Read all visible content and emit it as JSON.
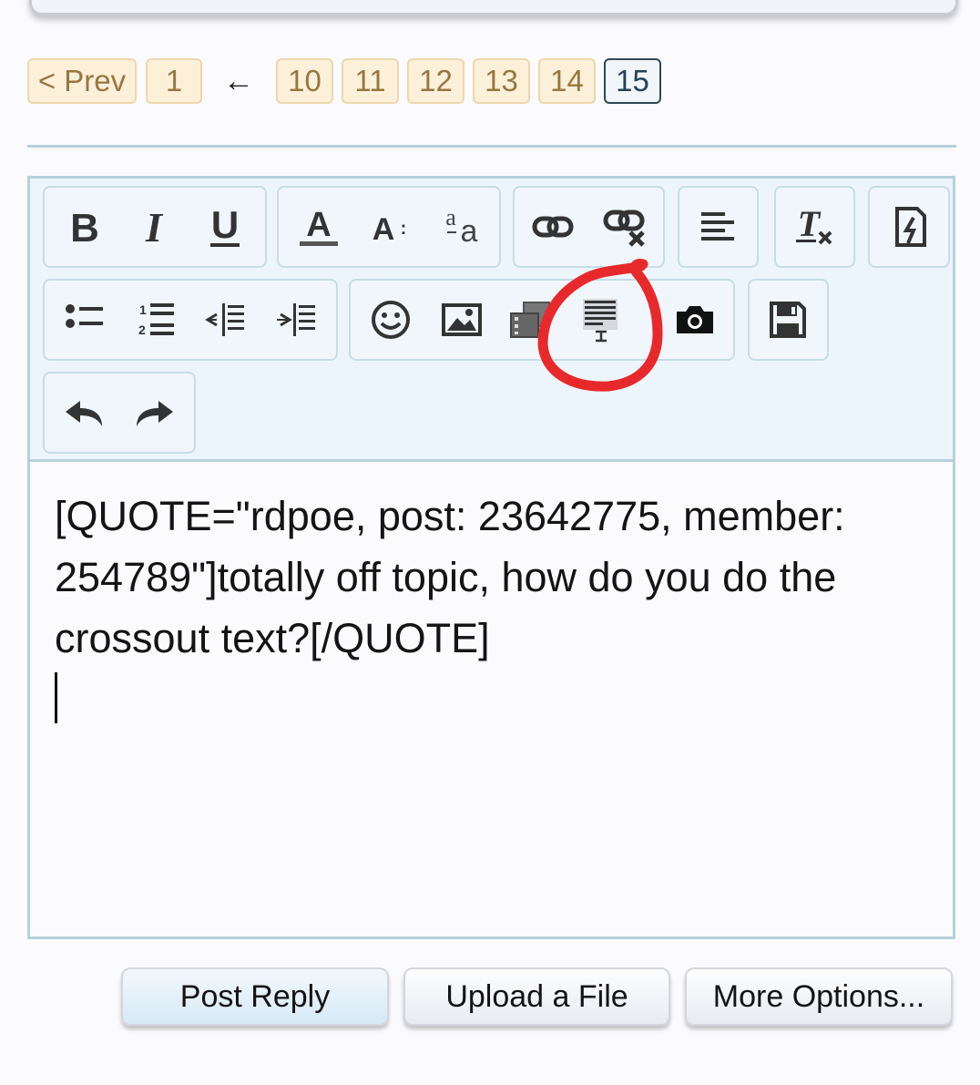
{
  "pagination": {
    "prev_label": "< Prev",
    "first_page": "1",
    "ellipsis_arrow": "←",
    "pages": [
      "10",
      "11",
      "12",
      "13",
      "14"
    ],
    "current_page": "15"
  },
  "toolbar": {
    "row1": [
      {
        "group": "text-style",
        "buttons": [
          "bold-icon",
          "italic-icon",
          "underline-icon"
        ]
      },
      {
        "group": "font",
        "buttons": [
          "font-color-icon",
          "font-size-icon",
          "font-family-icon"
        ]
      },
      {
        "group": "links",
        "buttons": [
          "link-icon",
          "unlink-icon"
        ]
      },
      {
        "group": "align",
        "buttons": [
          "align-icon"
        ]
      },
      {
        "group": "clear",
        "buttons": [
          "remove-format-icon"
        ]
      },
      {
        "group": "bbcode",
        "buttons": [
          "bbcode-toggle-icon"
        ]
      }
    ],
    "row2": [
      {
        "group": "lists",
        "buttons": [
          "bullet-list-icon",
          "numbered-list-icon",
          "outdent-icon",
          "indent-icon"
        ]
      },
      {
        "group": "insert",
        "buttons": [
          "smilie-icon",
          "image-icon",
          "media-icon",
          "insert-text-block-icon",
          "camera-icon"
        ]
      },
      {
        "group": "drafts",
        "buttons": [
          "save-draft-icon"
        ]
      }
    ],
    "row3": [
      {
        "group": "history",
        "buttons": [
          "undo-icon",
          "redo-icon"
        ]
      }
    ],
    "highlight_color": "#e8292b"
  },
  "editor": {
    "content": "[QUOTE=\"rdpoe, post: 23642775, member: 254789\"]totally off topic, how do you do the crossout text?[/QUOTE]"
  },
  "actions": {
    "post_reply": "Post Reply",
    "upload_file": "Upload a File",
    "more_options": "More Options..."
  },
  "colors": {
    "page_button_bg": "#fdf0d9",
    "page_button_text": "#967740",
    "current_page_border": "#2f4856",
    "editor_border": "#b6d1dc",
    "toolbar_bg": "#edf5fc"
  }
}
